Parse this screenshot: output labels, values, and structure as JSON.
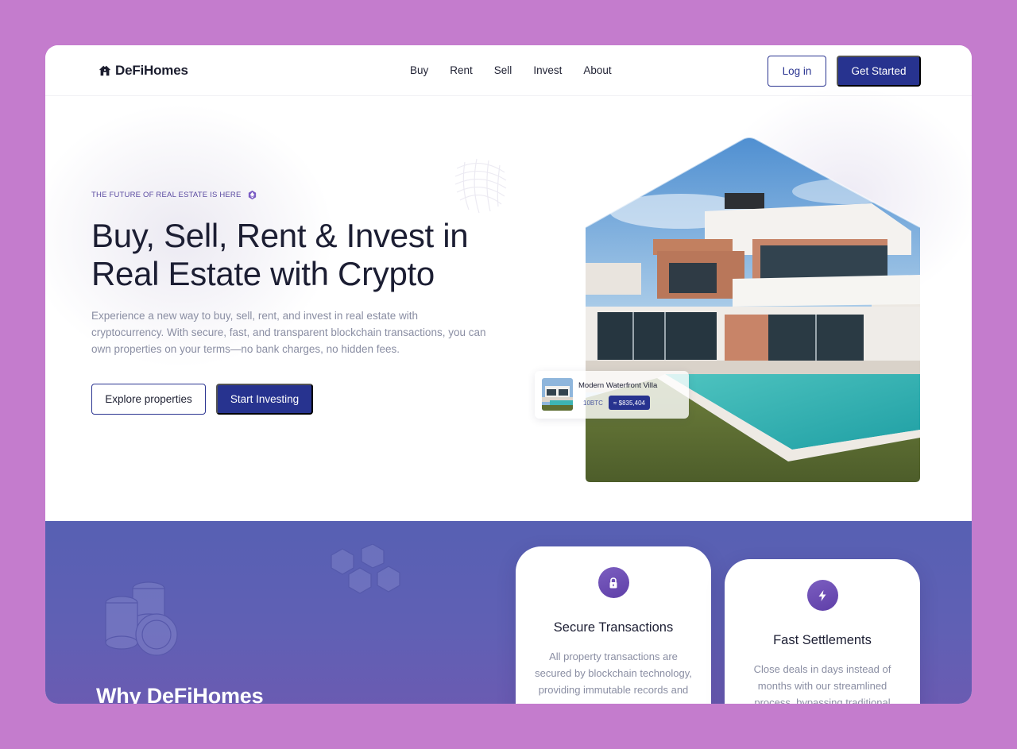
{
  "brand": {
    "name": "DeFiHomes"
  },
  "nav": {
    "links": [
      "Buy",
      "Rent",
      "Sell",
      "Invest",
      "About"
    ],
    "login_label": "Log in",
    "get_started_label": "Get Started"
  },
  "hero": {
    "eyebrow": "THE FUTURE OF REAL ESTATE IS HERE",
    "title_line1": "Buy, Sell, Rent & Invest in",
    "title_line2": "Real Estate with Crypto",
    "description": "Experience a new way to buy, sell, rent, and invest in real estate with cryptocurrency. With secure, fast, and transparent blockchain transactions, you can own properties on your terms—no bank charges, no hidden fees.",
    "explore_label": "Explore properties",
    "invest_label": "Start Investing"
  },
  "listing": {
    "name": "Modern Waterfront Villa",
    "price_btc": "10BTC",
    "price_usd": "≈ $835,404"
  },
  "features": {
    "section_title": "Why DeFiHomes",
    "cards": [
      {
        "icon": "lock-icon",
        "title": "Secure Transactions",
        "text": "All property transactions are secured by blockchain technology, providing immutable records and"
      },
      {
        "icon": "lightning-icon",
        "title": "Fast Settlements",
        "text": "Close deals in days instead of months with our streamlined process, bypassing traditional"
      }
    ]
  },
  "colors": {
    "page_bg": "#c47ccd",
    "primary": "#27338f",
    "band": "#5d60b3",
    "accent_purple": "#6a4bb0"
  }
}
